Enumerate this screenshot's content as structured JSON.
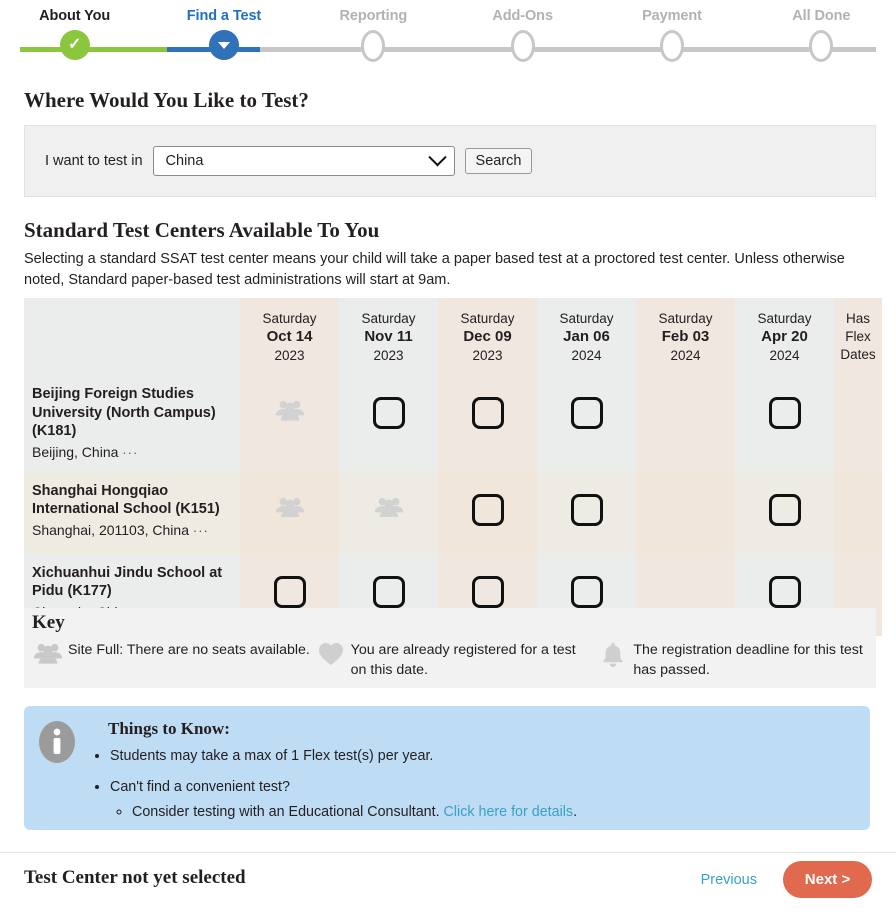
{
  "stepper": {
    "steps": [
      {
        "label": "About You",
        "state": "done"
      },
      {
        "label": "Find a Test",
        "state": "active"
      },
      {
        "label": "Reporting",
        "state": "todo"
      },
      {
        "label": "Add-Ons",
        "state": "todo"
      },
      {
        "label": "Payment",
        "state": "todo"
      },
      {
        "label": "All Done",
        "state": "todo"
      }
    ],
    "done_color": "#8cc63e",
    "active_color": "#2f72b8",
    "todo_color": "#c7c7c7"
  },
  "search": {
    "heading": "Where Would You Like to Test?",
    "label": "I want to test in",
    "selected_country": "China",
    "button_label": "Search"
  },
  "centers": {
    "heading": "Standard Test Centers Available To You",
    "description": "Selecting a standard SSAT test center means your child will take a paper based test at a proctored test center. Unless otherwise noted, Standard paper-based test administrations will start at 9am.",
    "flex_header": "Has Flex Dates",
    "columns": [
      {
        "dow": "Saturday",
        "date": "Oct 14",
        "year": "2023",
        "tint": "A"
      },
      {
        "dow": "Saturday",
        "date": "Nov 11",
        "year": "2023",
        "tint": "B"
      },
      {
        "dow": "Saturday",
        "date": "Dec 09",
        "year": "2023",
        "tint": "A"
      },
      {
        "dow": "Saturday",
        "date": "Jan 06",
        "year": "2024",
        "tint": "B"
      },
      {
        "dow": "Saturday",
        "date": "Feb 03",
        "year": "2024",
        "tint": "A"
      },
      {
        "dow": "Saturday",
        "date": "Apr 20",
        "year": "2024",
        "tint": "B"
      }
    ],
    "rows": [
      {
        "name": "Beijing Foreign Studies University (North Campus) (K181)",
        "location": "Beijing, China",
        "more": "···",
        "tint": false,
        "cells": [
          "full",
          "checkbox",
          "checkbox",
          "checkbox",
          "empty",
          "checkbox"
        ],
        "flex": "empty"
      },
      {
        "name": "Shanghai Hongqiao International School (K151)",
        "location": "Shanghai, 201103, China",
        "more": "···",
        "tint": true,
        "cells": [
          "full",
          "full",
          "checkbox",
          "checkbox",
          "empty",
          "checkbox"
        ],
        "flex": "empty"
      },
      {
        "name": "Xichuanhui Jindu School at Pidu (K177)",
        "location": "Chengdu, China",
        "more": "···",
        "tint": false,
        "cells": [
          "checkbox",
          "checkbox",
          "checkbox",
          "checkbox",
          "empty",
          "checkbox"
        ],
        "flex": "empty"
      }
    ]
  },
  "key": {
    "title": "Key",
    "items": [
      {
        "icon": "people-icon",
        "text": "Site Full: There are no seats available."
      },
      {
        "icon": "heart-icon",
        "text": "You are already registered for a test on this date."
      },
      {
        "icon": "bell-icon",
        "text": "The registration deadline for this test has passed."
      }
    ]
  },
  "info": {
    "title": "Things to Know:",
    "bullet1": "Students may take a max of 1 Flex test(s) per year.",
    "bullet2": "Can't find a convenient test?",
    "sub1_text": "Consider testing with an Educational Consultant. ",
    "sub1_link": "Click here for details",
    "sub1_tail": ".",
    "background": "#bfdcf5"
  },
  "footer": {
    "status": "Test Center not yet selected",
    "previous_label": "Previous",
    "next_label": "Next >",
    "next_color": "#e0694e",
    "link_color": "#3aa0c4"
  }
}
